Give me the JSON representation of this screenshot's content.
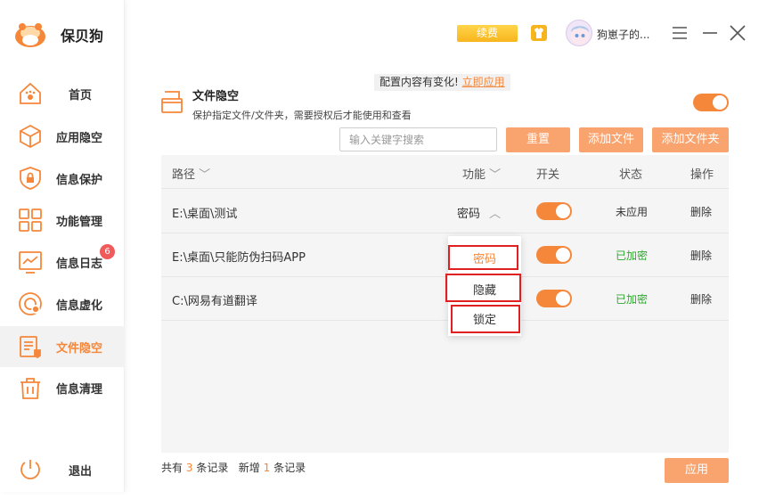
{
  "app": {
    "name": "保贝狗"
  },
  "header": {
    "renew_label": "续费",
    "username": "狗崽子的..."
  },
  "sidebar": {
    "items": [
      {
        "label": "首页",
        "icon": "paw-house-icon"
      },
      {
        "label": "应用隐空",
        "icon": "cube-icon"
      },
      {
        "label": "信息保护",
        "icon": "shield-lock-icon"
      },
      {
        "label": "功能管理",
        "icon": "grid-icon"
      },
      {
        "label": "信息日志",
        "icon": "chart-monitor-icon",
        "badge": "6"
      },
      {
        "label": "信息虚化",
        "icon": "disc-icon"
      },
      {
        "label": "文件隐空",
        "icon": "file-stack-icon",
        "active": true
      },
      {
        "label": "信息清理",
        "icon": "trash-icon"
      }
    ],
    "logout_label": "退出"
  },
  "notice": {
    "text": "配置内容有变化!",
    "link": "立即应用"
  },
  "section": {
    "title": "文件隐空",
    "description": "保护指定文件/文件夹，需要授权后才能使用和查看",
    "enabled": true
  },
  "toolbar": {
    "search_placeholder": "输入关键字搜索",
    "reset_label": "重置",
    "add_file_label": "添加文件",
    "add_folder_label": "添加文件夹"
  },
  "table": {
    "headers": {
      "path": "路径",
      "function": "功能",
      "switch": "开关",
      "status": "状态",
      "action": "操作"
    },
    "rows": [
      {
        "path": "E:\\桌面\\测试",
        "function": "密码",
        "switch": true,
        "status": "未应用",
        "action": "删除"
      },
      {
        "path": "E:\\桌面\\只能防伪扫码APP",
        "function": "",
        "switch": true,
        "status": "已加密",
        "action": "删除"
      },
      {
        "path": "C:\\网易有道翻译",
        "function": "",
        "switch": true,
        "status": "已加密",
        "action": "删除"
      }
    ]
  },
  "dropdown": {
    "options": [
      "密码",
      "隐藏",
      "锁定"
    ],
    "selected": "密码"
  },
  "footer": {
    "total_prefix": "共有",
    "total": "3",
    "total_suffix": "条记录",
    "new_prefix": "新增",
    "new": "1",
    "new_suffix": "条记录",
    "apply_label": "应用"
  },
  "colors": {
    "accent": "#f5873a",
    "button": "#f9a36e",
    "success": "#2fa82f",
    "badge": "#f05a5a",
    "highlight": "#e02020"
  }
}
